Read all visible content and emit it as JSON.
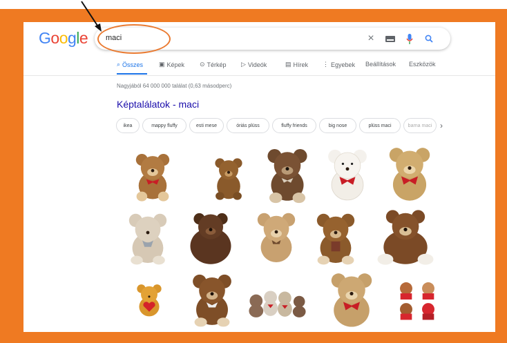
{
  "logo": {
    "G": "G",
    "o1": "o",
    "o2": "o",
    "g": "g",
    "l": "l",
    "e": "e"
  },
  "search": {
    "query": "maci"
  },
  "tabs": [
    {
      "label": "Összes",
      "icon": "search-icon"
    },
    {
      "label": "Képek",
      "icon": "image-icon"
    },
    {
      "label": "Térkép",
      "icon": "map-pin-icon"
    },
    {
      "label": "Videók",
      "icon": "video-icon"
    },
    {
      "label": "Hírek",
      "icon": "news-icon"
    },
    {
      "label": "Egyebek",
      "icon": "more-icon"
    },
    {
      "label": "Beállítások"
    },
    {
      "label": "Eszközök"
    }
  ],
  "results_stats": "Nagyjából 64 000 000 találat (0,63 másodperc)",
  "image_results_heading": "Képtalálatok - maci",
  "chips": [
    "ikea",
    "mappy fluffy",
    "esti mese",
    "óriás plüss",
    "fluffy friends",
    "big nose",
    "plüss maci",
    "barna maci"
  ],
  "icons": {
    "clear": "close-icon",
    "keyboard": "keyboard-icon",
    "mic": "microphone-icon",
    "search": "search-icon",
    "chips_next": "chevron-right-icon"
  },
  "colors": {
    "frame": "#ef7a22",
    "link": "#1a0dab",
    "accent": "#1a73e8",
    "annotation": "#ea7a30"
  }
}
